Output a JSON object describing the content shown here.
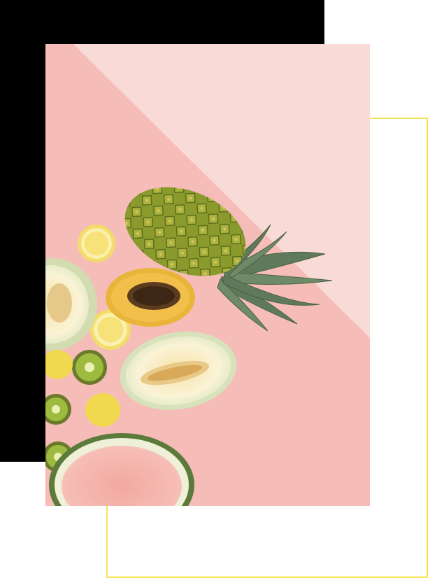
{
  "image": {
    "subject": "fruit-flatlay",
    "elements": [
      "pineapple",
      "papaya",
      "lemon",
      "kiwi",
      "melon",
      "watermelon"
    ]
  },
  "colors": {
    "background": "#ffffff",
    "block": "#000000",
    "frame": "#f7e35a",
    "pink_light": "#f8d9d6",
    "pink": "#f5b9b5"
  }
}
